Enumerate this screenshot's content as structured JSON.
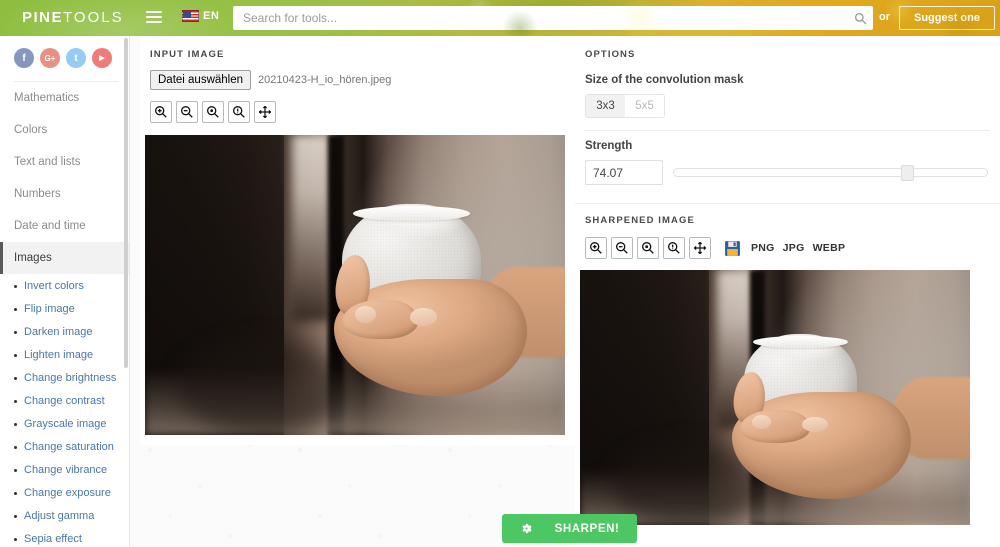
{
  "header": {
    "logo_bold": "PINE",
    "logo_thin": "TOOLS",
    "menu_icon": "hamburger-icon",
    "language": "EN",
    "flag_icon": "us-flag-icon",
    "search_placeholder": "Search for tools...",
    "search_value": "",
    "search_icon": "search-icon",
    "or_label": "or",
    "suggest_label": "Suggest one"
  },
  "sidebar": {
    "social": [
      {
        "name": "facebook",
        "glyph": "f"
      },
      {
        "name": "google-plus",
        "glyph": "G+"
      },
      {
        "name": "twitter",
        "glyph": "t"
      },
      {
        "name": "youtube",
        "glyph": "▶"
      }
    ],
    "categories": [
      "Mathematics",
      "Colors",
      "Text and lists",
      "Numbers",
      "Date and time",
      "Images"
    ],
    "active_category": "Images",
    "tools": [
      "Invert colors",
      "Flip image",
      "Darken image",
      "Lighten image",
      "Change brightness",
      "Change contrast",
      "Grayscale image",
      "Change saturation",
      "Change vibrance",
      "Change exposure",
      "Adjust gamma",
      "Sepia effect"
    ]
  },
  "input_panel": {
    "title": "INPUT IMAGE",
    "file_button": "Datei auswählen",
    "file_name": "20210423-H_io_hören.jpeg",
    "tools": [
      {
        "name": "zoom-in-icon"
      },
      {
        "name": "zoom-out-icon"
      },
      {
        "name": "zoom-fit-icon"
      },
      {
        "name": "zoom-actual-size-icon"
      },
      {
        "name": "pan-move-icon"
      }
    ]
  },
  "options_panel": {
    "title": "OPTIONS",
    "mask_label": "Size of the convolution mask",
    "mask_options": [
      "3x3",
      "5x5"
    ],
    "mask_selected": "3x3",
    "strength_label": "Strength",
    "strength_value": "74.07",
    "strength_percent": 74.07
  },
  "output_panel": {
    "title": "SHARPENED IMAGE",
    "tools": [
      {
        "name": "zoom-in-icon"
      },
      {
        "name": "zoom-out-icon"
      },
      {
        "name": "zoom-fit-icon"
      },
      {
        "name": "zoom-actual-size-icon"
      },
      {
        "name": "pan-move-icon"
      },
      {
        "name": "save-floppy-icon"
      }
    ],
    "formats": [
      "PNG",
      "JPG",
      "WEBP"
    ]
  },
  "action": {
    "label": "SHARPEN!",
    "icon": "gear-icon"
  },
  "colors": {
    "accent_green": "#4cc764",
    "header_green": "#8dbe3f",
    "header_gold": "#d9a216",
    "link_blue": "#4a76a8"
  }
}
